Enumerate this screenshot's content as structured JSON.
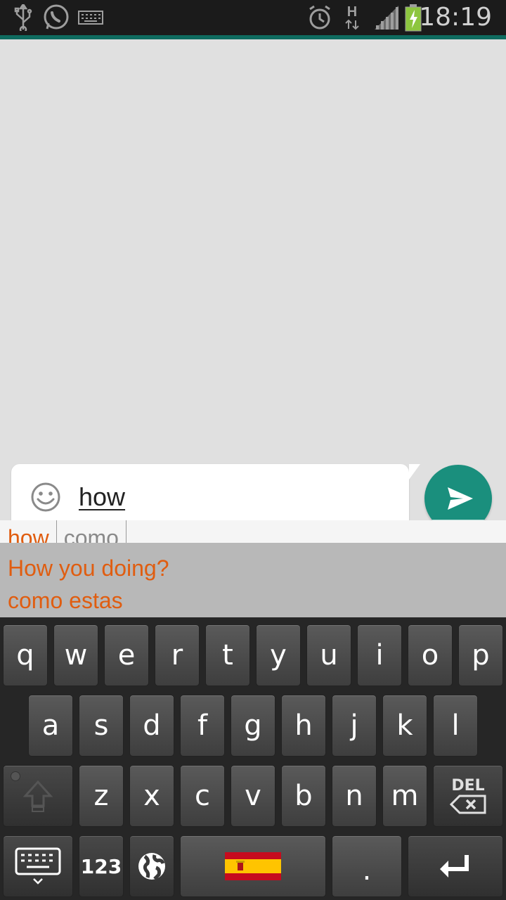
{
  "status_bar": {
    "time": "18:19",
    "icons": [
      "usb-icon",
      "whatsapp-icon",
      "keyboard-icon",
      "alarm-icon",
      "hspa-data-icon",
      "signal-icon",
      "battery-charging-icon"
    ],
    "network_label": "H"
  },
  "composer": {
    "input_value": "how",
    "emoji_icon": "emoji-icon",
    "send_icon": "send-icon"
  },
  "suggestions": {
    "words": [
      "how",
      "como"
    ],
    "phrases": [
      "How you doing?",
      "como estas"
    ]
  },
  "keyboard": {
    "row1": [
      "q",
      "w",
      "e",
      "r",
      "t",
      "y",
      "u",
      "i",
      "o",
      "p"
    ],
    "row2": [
      "a",
      "s",
      "d",
      "f",
      "g",
      "h",
      "j",
      "k",
      "l"
    ],
    "row3": [
      "z",
      "x",
      "c",
      "v",
      "b",
      "n",
      "m"
    ],
    "del_label": "DEL",
    "numbers_label": "123",
    "period_label": ".",
    "space_language": "Spanish (flag)"
  },
  "colors": {
    "accent": "#1a8f7d",
    "suggestion_text": "#e05d10"
  }
}
